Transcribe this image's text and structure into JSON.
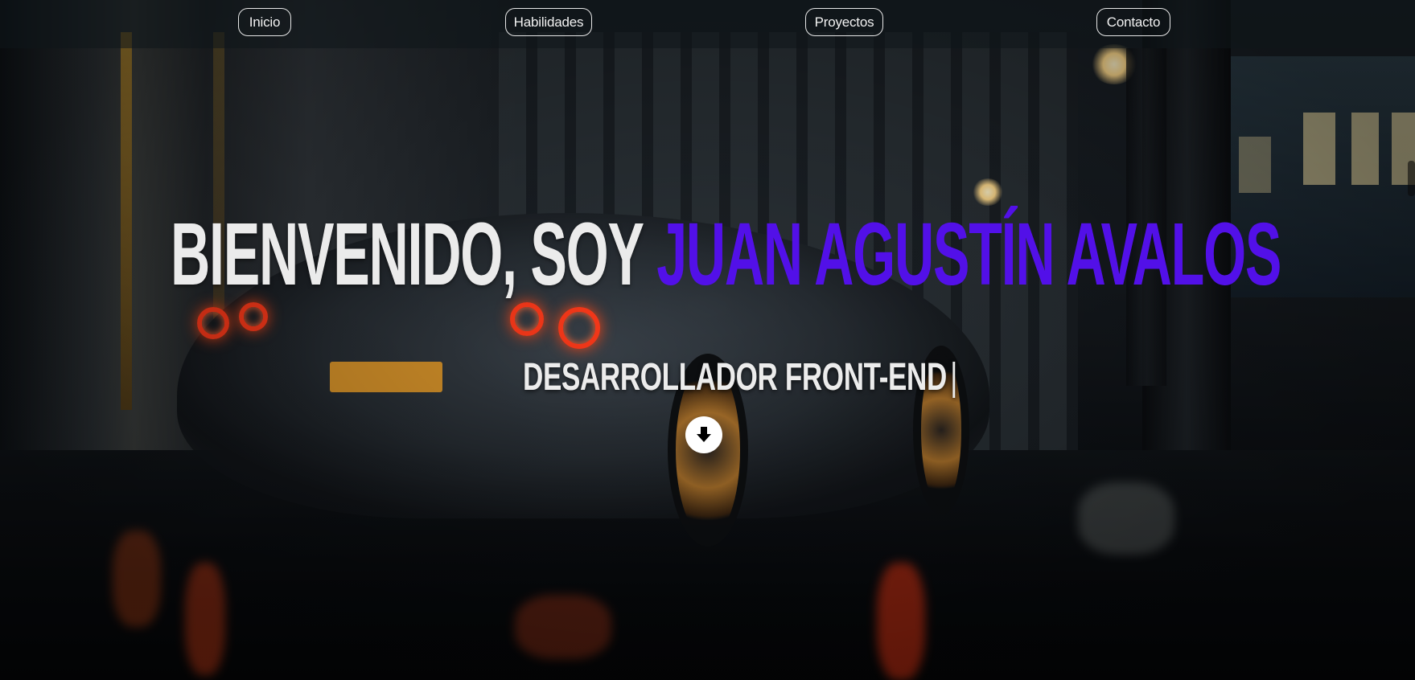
{
  "nav": {
    "items": [
      {
        "label": "Inicio"
      },
      {
        "label": "Habilidades"
      },
      {
        "label": "Proyectos"
      },
      {
        "label": "Contacto"
      }
    ]
  },
  "hero": {
    "greeting": "BIENVENIDO, SOY ",
    "name": "JUAN AGUSTÍN AVALOS",
    "role": "DESARROLLADOR FRONT-END",
    "cursor": "|",
    "download_icon": "download-arrow-icon"
  },
  "colors": {
    "accent": "#5210e8",
    "text": "#ebebeb",
    "nav_border": "#e8e8e8"
  }
}
